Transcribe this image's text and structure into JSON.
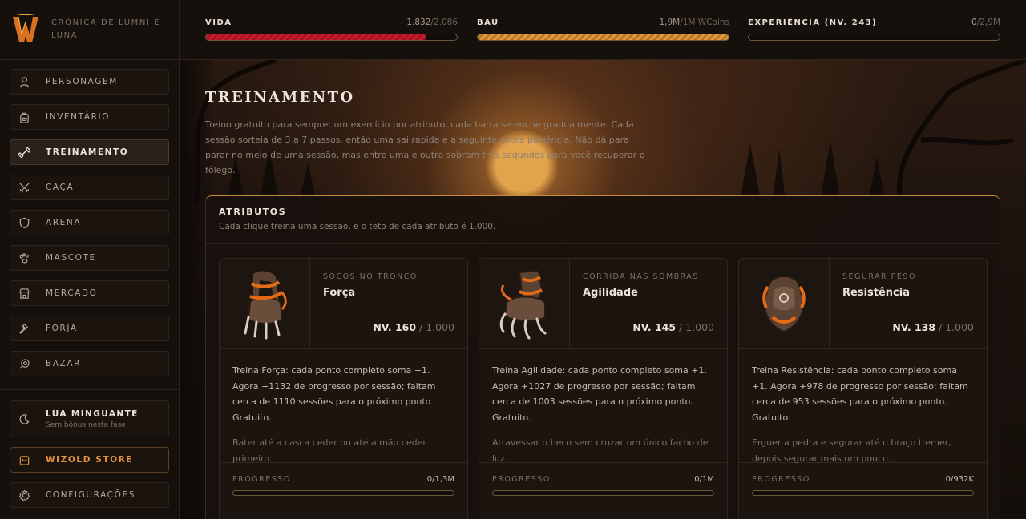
{
  "brand": {
    "title": "Crônica de Lumni e Luna",
    "logo_letter": "W"
  },
  "sidebar": {
    "items": [
      {
        "label": "Personagem",
        "icon": "user-icon",
        "active": false
      },
      {
        "label": "Inventário",
        "icon": "backpack-icon",
        "active": false
      },
      {
        "label": "Treinamento",
        "icon": "dumbbell-icon",
        "active": true
      },
      {
        "label": "Caça",
        "icon": "crossed-swords-icon",
        "active": false
      },
      {
        "label": "Arena",
        "icon": "shield-icon",
        "active": false
      },
      {
        "label": "Mascote",
        "icon": "paw-icon",
        "active": false
      },
      {
        "label": "Mercado",
        "icon": "store-icon",
        "active": false
      },
      {
        "label": "Forja",
        "icon": "hammer-icon",
        "active": false
      },
      {
        "label": "Bazar",
        "icon": "coin-tag-icon",
        "active": false
      }
    ],
    "moon": {
      "title": "Lua minguante",
      "subtitle": "Sem bônus nesta fase"
    },
    "store": {
      "label": "Wizold Store"
    },
    "settings": {
      "label": "Configurações"
    }
  },
  "stats": {
    "vida": {
      "label": "VIDA",
      "current": "1.832",
      "max": "/2.086",
      "fraction": 0.878
    },
    "bau": {
      "label": "BAÚ",
      "current": "1,9M",
      "max": "/1M WCoins",
      "fraction": 1.0
    },
    "xp": {
      "label": "EXPERIÊNCIA (NV. 243)",
      "current": "0",
      "max": "/2,9M",
      "fraction": 0.0
    }
  },
  "page": {
    "title": "TREINAMENTO",
    "description": "Treino gratuito para sempre: um exercício por atributo, cada barra se enche gradualmente. Cada sessão sorteia de 3 a 7 passos, então uma sai rápida e a seguinte cobra paciência. Não dá para parar no meio de uma sessão, mas entre uma e outra sobram três segundos para você recuperar o fôlego."
  },
  "panel": {
    "title": "ATRIBUTOS",
    "subtitle": "Cada clique treina uma sessão, e o teto de cada atributo é 1.000."
  },
  "cards": [
    {
      "kicker": "Socos no tronco",
      "name": "Força",
      "level_label": "NV. 160",
      "level_max": " / 1.000",
      "text": "Treina Força: cada ponto completo soma +1. Agora +1132 de progresso por sessão; faltam cerca de 1110 sessões para o próximo ponto. Gratuito.",
      "flavor": "Bater até a casca ceder ou até a mão ceder primeiro.",
      "progress_label": "PROGRESSO",
      "progress_value": "0/1,3M",
      "progress_fraction": 0.0,
      "icon": "gauntlet-icon"
    },
    {
      "kicker": "Corrida nas sombras",
      "name": "Agilidade",
      "level_label": "NV. 145",
      "level_max": " / 1.000",
      "text": "Treina Agilidade: cada ponto completo soma +1. Agora +1027 de progresso por sessão; faltam cerca de 1003 sessões para o próximo ponto. Gratuito.",
      "flavor": "Atravessar o beco sem cruzar um único facho de luz.",
      "progress_label": "PROGRESSO",
      "progress_value": "0/1M",
      "progress_fraction": 0.0,
      "icon": "claw-gauntlet-icon"
    },
    {
      "kicker": "Segurar peso",
      "name": "Resistência",
      "level_label": "NV. 138",
      "level_max": " / 1.000",
      "text": "Treina Resistência: cada ponto completo soma +1. Agora +978 de progresso por sessão; faltam cerca de 953 sessões para o próximo ponto. Gratuito.",
      "flavor": "Erguer a pedra e segurar até o braço tremer, depois segurar mais um pouco.",
      "progress_label": "PROGRESSO",
      "progress_value": "0/932K",
      "progress_fraction": 0.0,
      "icon": "armor-icon"
    }
  ],
  "colors": {
    "accent": "#e3933f",
    "health": "#c91a2e",
    "gold": "#e39a3a",
    "background": "#120d0a"
  }
}
